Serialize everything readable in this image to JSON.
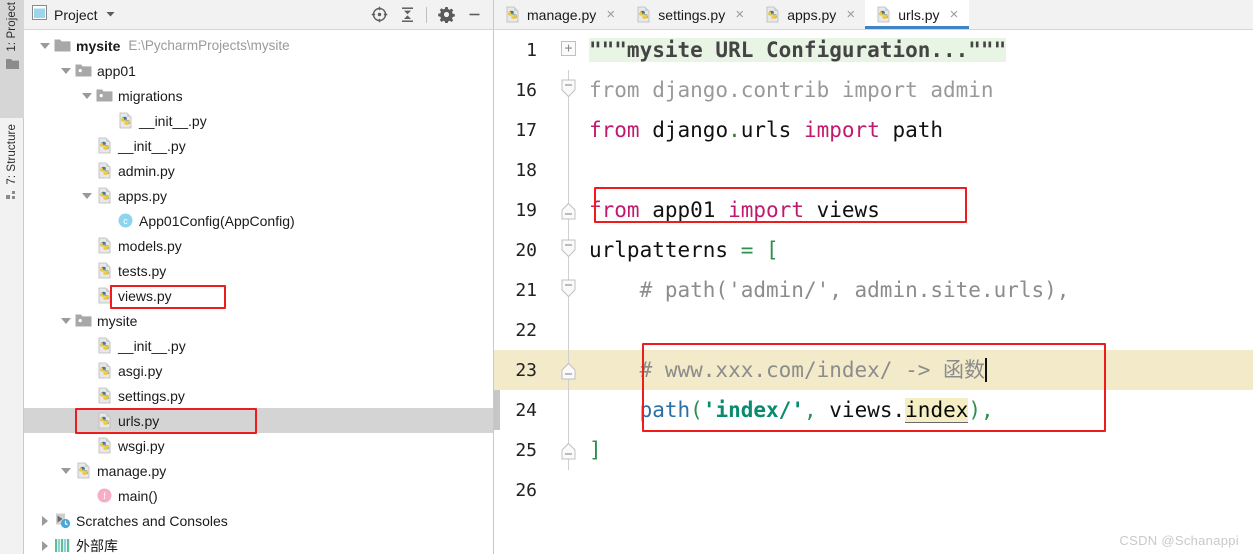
{
  "toolstrip": {
    "buttons": [
      {
        "label": "1: Project",
        "underline": "1",
        "icon": "folder-icon",
        "active": true
      },
      {
        "label": "7: Structure",
        "underline": "7",
        "icon": "structure-icon",
        "active": false
      }
    ]
  },
  "project_panel": {
    "title": "Project",
    "dropdown_icon": "chevron-down-icon",
    "panel_icon": "project-window-icon",
    "actions": [
      {
        "name": "locate-icon",
        "glyph": "target"
      },
      {
        "name": "collapse-all-icon",
        "glyph": "collapse"
      },
      {
        "name": "gear-icon",
        "glyph": "gear"
      },
      {
        "name": "minimize-icon",
        "glyph": "minus"
      }
    ],
    "tree": [
      {
        "indent": 0,
        "arrow": "down",
        "icon": "folder-icon",
        "label": "mysite",
        "bold": true,
        "path": "E:\\PycharmProjects\\mysite"
      },
      {
        "indent": 1,
        "arrow": "down",
        "icon": "module-folder-icon",
        "label": "app01"
      },
      {
        "indent": 2,
        "arrow": "down",
        "icon": "module-folder-icon",
        "label": "migrations"
      },
      {
        "indent": 3,
        "arrow": "none",
        "icon": "python-file-icon",
        "label": "__init__.py"
      },
      {
        "indent": 2,
        "arrow": "none",
        "icon": "python-file-icon",
        "label": "__init__.py"
      },
      {
        "indent": 2,
        "arrow": "none",
        "icon": "python-file-icon",
        "label": "admin.py"
      },
      {
        "indent": 2,
        "arrow": "down",
        "icon": "python-file-icon",
        "label": "apps.py"
      },
      {
        "indent": 3,
        "arrow": "none",
        "icon": "class-icon",
        "label": "App01Config(AppConfig)"
      },
      {
        "indent": 2,
        "arrow": "none",
        "icon": "python-file-icon",
        "label": "models.py"
      },
      {
        "indent": 2,
        "arrow": "none",
        "icon": "python-file-icon",
        "label": "tests.py"
      },
      {
        "indent": 2,
        "arrow": "none",
        "icon": "python-file-icon",
        "label": "views.py",
        "highlight": true
      },
      {
        "indent": 1,
        "arrow": "down",
        "icon": "module-folder-icon",
        "label": "mysite"
      },
      {
        "indent": 2,
        "arrow": "none",
        "icon": "python-file-icon",
        "label": "__init__.py"
      },
      {
        "indent": 2,
        "arrow": "none",
        "icon": "python-file-icon",
        "label": "asgi.py"
      },
      {
        "indent": 2,
        "arrow": "none",
        "icon": "python-file-icon",
        "label": "settings.py"
      },
      {
        "indent": 2,
        "arrow": "none",
        "icon": "python-file-icon",
        "label": "urls.py",
        "selected": true,
        "highlight": true
      },
      {
        "indent": 2,
        "arrow": "none",
        "icon": "python-file-icon",
        "label": "wsgi.py"
      },
      {
        "indent": 1,
        "arrow": "down",
        "icon": "python-file-icon",
        "label": "manage.py"
      },
      {
        "indent": 2,
        "arrow": "none",
        "icon": "function-icon",
        "label": "main()"
      },
      {
        "indent": 0,
        "arrow": "right",
        "icon": "scratches-icon",
        "label": "Scratches and Consoles"
      },
      {
        "indent": 0,
        "arrow": "right",
        "icon": "library-icon",
        "label": "外部库"
      }
    ]
  },
  "editor": {
    "tabs": [
      {
        "label": "manage.py",
        "icon": "python-file-icon",
        "close": "×",
        "active": false
      },
      {
        "label": "settings.py",
        "icon": "python-file-icon",
        "close": "×",
        "active": false
      },
      {
        "label": "apps.py",
        "icon": "python-file-icon",
        "close": "×",
        "active": false
      },
      {
        "label": "urls.py",
        "icon": "python-file-icon",
        "close": "×",
        "active": true
      }
    ],
    "lines": [
      {
        "num": "1",
        "fold": "plus",
        "text": "\"\"\"mysite URL Configuration...\"\"\""
      },
      {
        "num": "16",
        "fold": "start",
        "text": "from django.contrib import admin"
      },
      {
        "num": "17",
        "fold": "none",
        "text": "from django.urls import path"
      },
      {
        "num": "18",
        "fold": "none",
        "text": ""
      },
      {
        "num": "19",
        "fold": "end",
        "text": "from app01 import views",
        "highlight": true
      },
      {
        "num": "20",
        "fold": "start",
        "text": "urlpatterns = ["
      },
      {
        "num": "21",
        "fold": "start",
        "text": "    # path('admin/', admin.site.urls),"
      },
      {
        "num": "22",
        "fold": "none",
        "text": ""
      },
      {
        "num": "23",
        "fold": "end",
        "text": "    # www.xxx.com/index/ -> 函数",
        "caret_line": true,
        "highlight": true
      },
      {
        "num": "24",
        "fold": "none",
        "text": "    path('index/', views.index),",
        "highlight": true
      },
      {
        "num": "25",
        "fold": "end",
        "text": "]"
      },
      {
        "num": "26",
        "fold": "none",
        "text": ""
      }
    ]
  },
  "watermark": "CSDN @Schanappi",
  "colors": {
    "accent_tab": "#4083c9",
    "annotation_red": "#ef1c1c",
    "caret_line": "#f2eac9",
    "docstring_bg": "#e9f5e4",
    "selection_row": "#d4d4d4",
    "keyword": "#c01a6e",
    "string": "#0a8a6e",
    "comment": "#8c8c8c",
    "function": "#2a6ea6"
  }
}
